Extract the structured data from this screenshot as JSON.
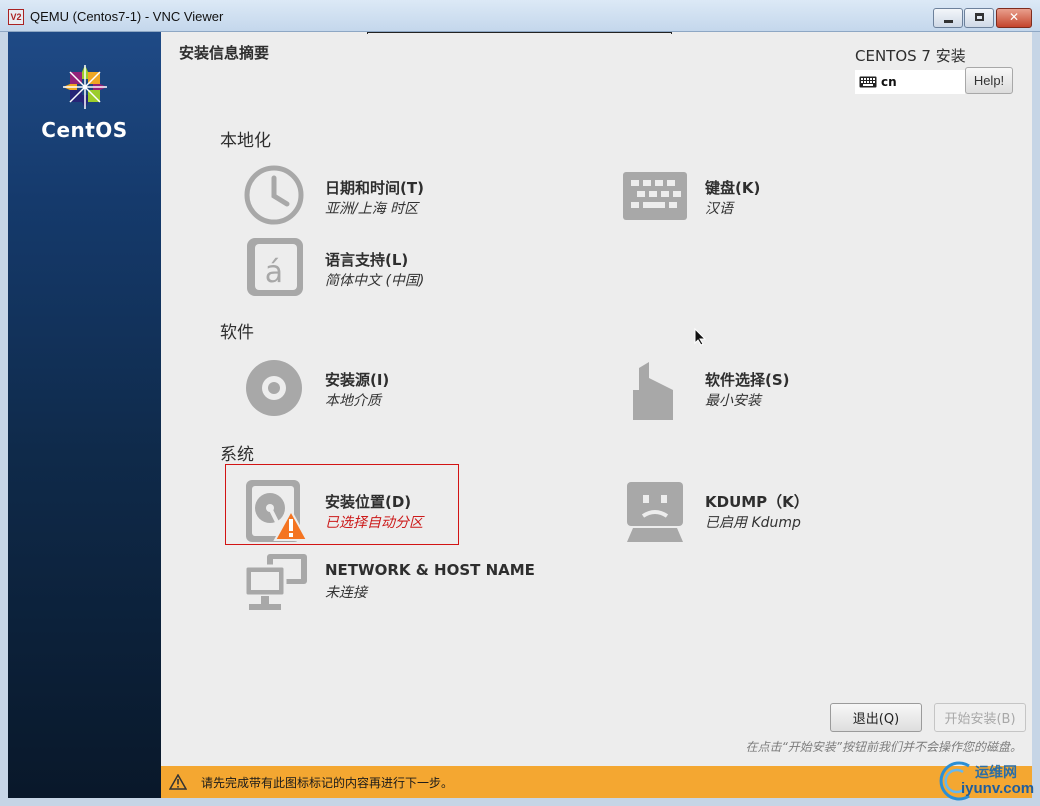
{
  "window": {
    "title": "QEMU (Centos7-1) - VNC Viewer",
    "logo_text": "V2"
  },
  "brand": {
    "logo_text": "CentOS"
  },
  "header": {
    "page_title": "安装信息摘要",
    "product_title": "CENTOS 7 安装",
    "keyboard_layout": "cn",
    "help_label": "Help!"
  },
  "sections": {
    "localization": "本地化",
    "software": "软件",
    "system": "系统"
  },
  "spokes": {
    "datetime": {
      "name": "日期和时间(T)",
      "status": "亚洲/上海 时区",
      "icon": "clock-icon"
    },
    "keyboard": {
      "name": "键盘(K)",
      "status": "汉语",
      "icon": "keyboard-icon"
    },
    "language": {
      "name": "语言支持(L)",
      "status": "简体中文 (中国)",
      "icon": "language-icon"
    },
    "source": {
      "name": "安装源(I)",
      "status": "本地介质",
      "icon": "disc-icon"
    },
    "software": {
      "name": "软件选择(S)",
      "status": "最小安装",
      "icon": "package-icon"
    },
    "destination": {
      "name": "安装位置(D)",
      "status": "已选择自动分区",
      "icon": "harddisk-warning-icon"
    },
    "kdump": {
      "name": "KDUMP（K）",
      "status": "已启用 Kdump",
      "icon": "sad-face-icon"
    },
    "network": {
      "name": "NETWORK & HOST NAME",
      "status": "未连接",
      "icon": "network-icon"
    }
  },
  "footer": {
    "quit_label": "退出(Q)",
    "begin_label": "开始安装(B)",
    "hint": "在点击“开始安装”按钮前我们并不会操作您的磁盘。",
    "warning_message": "请先完成带有此图标标记的内容再进行下一步。"
  },
  "watermark": {
    "top": "运维网",
    "bottom": "iyunv.com"
  },
  "colors": {
    "sidebar_top": "#1f4a86",
    "sidebar_bottom": "#09182a",
    "icon_gray": "#a8a8a8",
    "warning_orange": "#f4a731",
    "alert_red": "#d21414"
  }
}
